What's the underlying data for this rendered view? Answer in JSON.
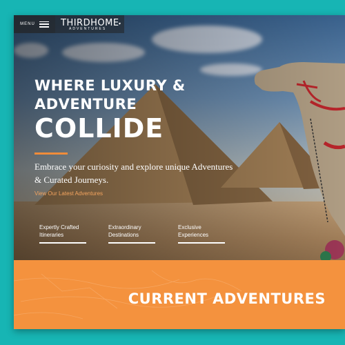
{
  "header": {
    "menu_label": "MENU",
    "logo_main": "THIRDHOME",
    "logo_sub": "ADVENTURES"
  },
  "hero": {
    "headline_line1": "WHERE LUXURY &",
    "headline_line2": "ADVENTURE",
    "headline_line3": "COLLIDE",
    "tagline": "Embrace your curiosity and explore unique Adventures & Curated Journeys.",
    "cta_link": "View Our Latest Adventures"
  },
  "features": [
    {
      "line1": "Expertly Crafted",
      "line2": "Itineraries"
    },
    {
      "line1": "Extraordinary",
      "line2": "Destinations"
    },
    {
      "line1": "Exclusive",
      "line2": "Experiences"
    }
  ],
  "section": {
    "title": "CURRENT ADVENTURES"
  },
  "colors": {
    "frame": "#17b5b4",
    "accent_orange": "#f4923e",
    "link_orange": "#f4a45f"
  },
  "icons": {
    "menu": "hamburger-icon",
    "logo_dropdown": "chevron-down-icon"
  }
}
